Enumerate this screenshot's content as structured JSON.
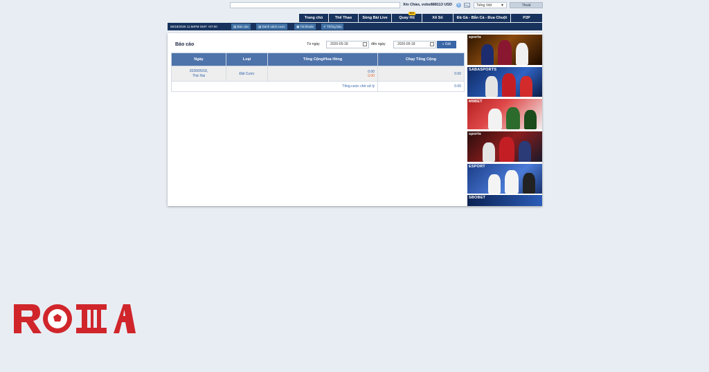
{
  "header": {
    "welcome_prefix": "Xin Chào,",
    "username": "vobs888113",
    "currency": "USD",
    "language": "Tiếng Việt",
    "logout": "Thoát"
  },
  "nav": {
    "tabs": [
      {
        "label": "Trang chủ"
      },
      {
        "label": "Thể Thao"
      },
      {
        "label": "Sòng Bài Live"
      },
      {
        "label": "Quay Hũ",
        "badge": "Mới"
      },
      {
        "label": "Xổ Số"
      },
      {
        "label": "Đá Gà - Bắn Cá - Đua Chuột"
      },
      {
        "label": "P2P"
      }
    ]
  },
  "subnav": {
    "datetime": "05/18/2026 11:58PM GMT +07:00",
    "items": [
      "Báo cáo",
      "Danh sách cược",
      "Tài khoản",
      "Thông báo"
    ]
  },
  "report": {
    "title": "Báo cáo",
    "from_label": "Từ ngày",
    "from_date": "2026-05-18",
    "to_label": "đến ngày",
    "to_date": "2026-05-18",
    "send_label": "Gửi",
    "columns": [
      "Ngày",
      "Loại",
      "Tổng Cộng/Hoa Hồng",
      "Chạy Tổng Cộng"
    ],
    "rows": [
      {
        "date": "2026/05/18,",
        "weekday": "Thứ Hai",
        "type": "Đặt Cược",
        "total": "0.00",
        "commission": "0.00",
        "running": "0.00"
      }
    ],
    "pending_label": "Tổng cược chờ xử lý",
    "pending_value": "0.00"
  },
  "banners": [
    {
      "label": "sports"
    },
    {
      "label": "SABASPORTS"
    },
    {
      "label": "M9BET"
    },
    {
      "label": "sports"
    },
    {
      "label": "ESPORT"
    },
    {
      "label": "SBOBET"
    }
  ],
  "colors": {
    "nav_bg": "#17325c",
    "table_header": "#4e73ab",
    "link_blue": "#2a5ba8",
    "accent_orange": "#e0622a",
    "logo_red": "#d0262b",
    "page_bg": "#e8edf3"
  },
  "logo_text": "ROMA"
}
